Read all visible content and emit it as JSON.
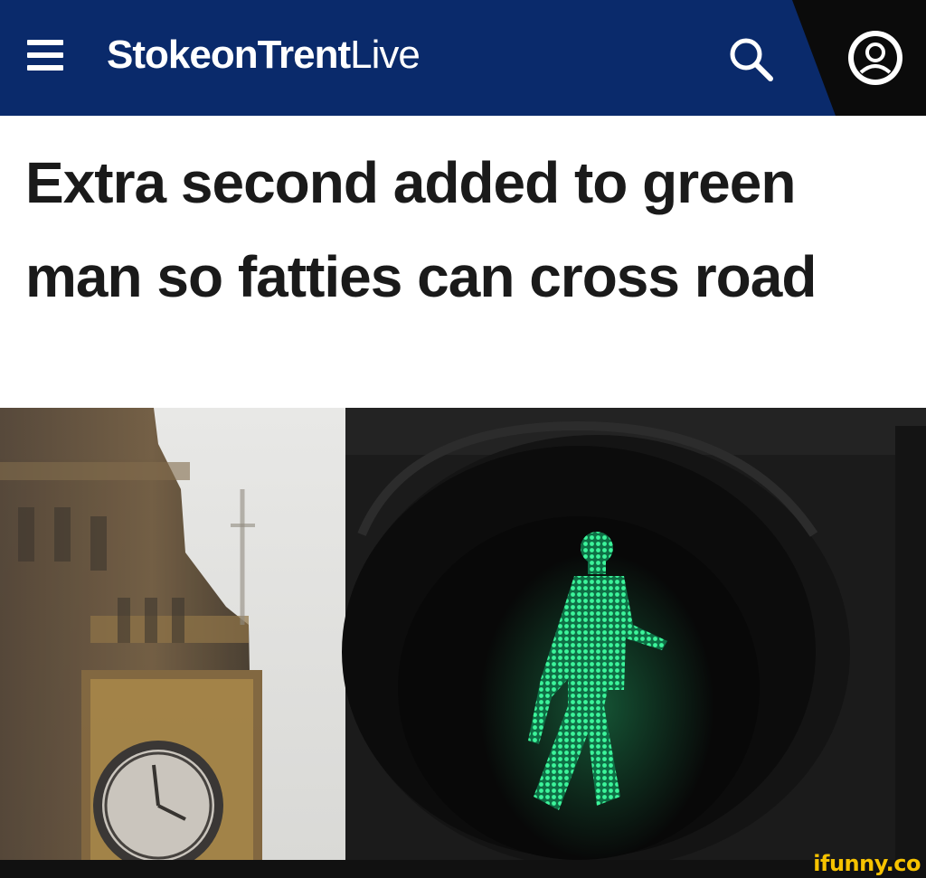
{
  "header": {
    "site_name_bold": "StokeonTrent",
    "site_name_light": "Live",
    "menu_icon": "hamburger-menu-icon",
    "search_icon": "search-icon",
    "account_icon": "account-icon"
  },
  "article": {
    "headline": "Extra second added to green man so fatties can cross road"
  },
  "photo": {
    "subject": "green-pedestrian-signal"
  },
  "watermark": "ifunny.co",
  "colors": {
    "header_bg": "#0a2a6b",
    "header_corner": "#0b0b0b",
    "headline_text": "#1a1a1a",
    "signal_green": "#2ee58a",
    "watermark": "#f6c200"
  }
}
